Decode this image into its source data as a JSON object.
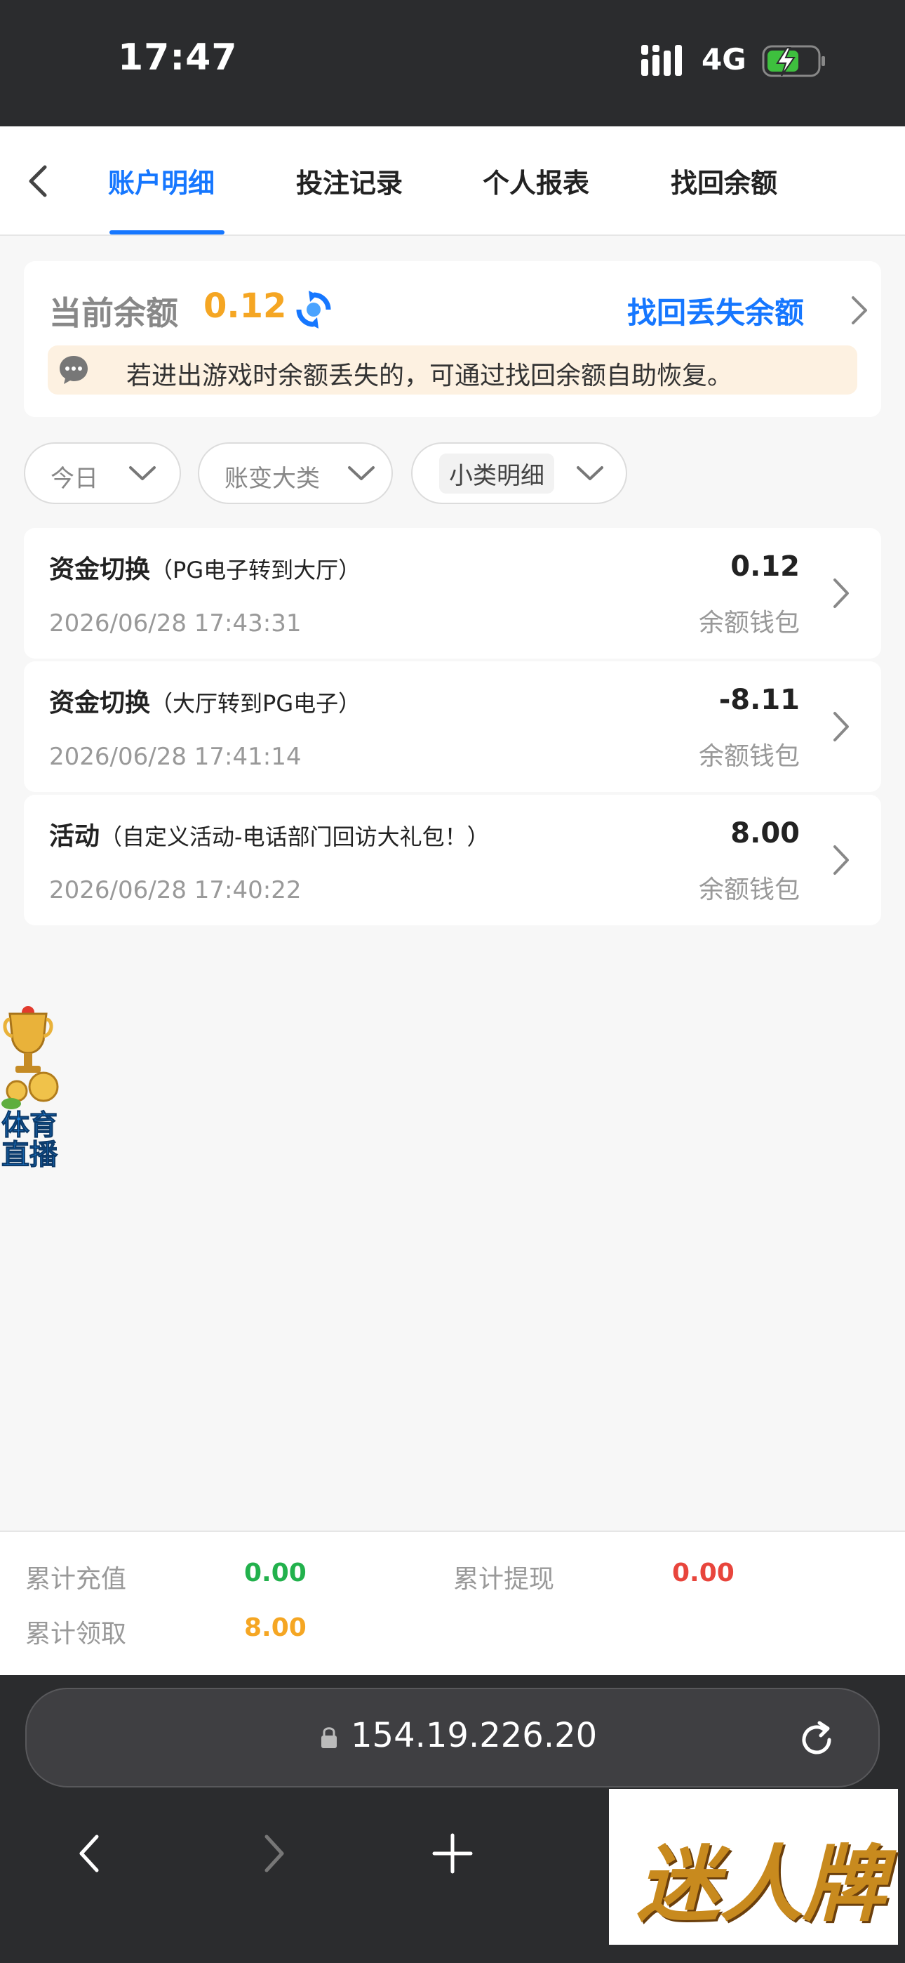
{
  "status_bar": {
    "time": "17:47",
    "network": "4G"
  },
  "tabs": {
    "items": [
      {
        "label": "账户明细",
        "active": true
      },
      {
        "label": "投注记录",
        "active": false
      },
      {
        "label": "个人报表",
        "active": false
      },
      {
        "label": "找回余额",
        "active": false
      }
    ]
  },
  "balance": {
    "label": "当前余额",
    "value": "0.12",
    "recover_link": "找回丢失余额",
    "notice": "若进出游戏时余额丢失的，可通过找回余额自助恢复。"
  },
  "filters": {
    "date": "今日",
    "category": "账变大类",
    "subcategory": "小类明细"
  },
  "records": [
    {
      "type": "资金切换",
      "detail": "（PG电子转到大厅）",
      "time": "2026/06/28 17:43:31",
      "amount": "0.12",
      "wallet": "余额钱包"
    },
    {
      "type": "资金切换",
      "detail": "（大厅转到PG电子）",
      "time": "2026/06/28 17:41:14",
      "amount": "-8.11",
      "wallet": "余额钱包"
    },
    {
      "type": "活动",
      "detail": "（自定义活动-电话部门回访大礼包！）",
      "time": "2026/06/28 17:40:22",
      "amount": "8.00",
      "wallet": "余额钱包"
    }
  ],
  "float_badge": {
    "line1": "体育",
    "line2": "直播"
  },
  "summary": {
    "recharge_label": "累计充值",
    "recharge_value": "0.00",
    "withdraw_label": "累计提现",
    "withdraw_value": "0.00",
    "claim_label": "累计领取",
    "claim_value": "8.00"
  },
  "browser": {
    "url": "154.19.226.20"
  },
  "logo": {
    "text": "迷人牌"
  },
  "colors": {
    "accent": "#1677ff",
    "balance": "#f5a623",
    "green": "#22b14c",
    "red": "#e8453c"
  }
}
